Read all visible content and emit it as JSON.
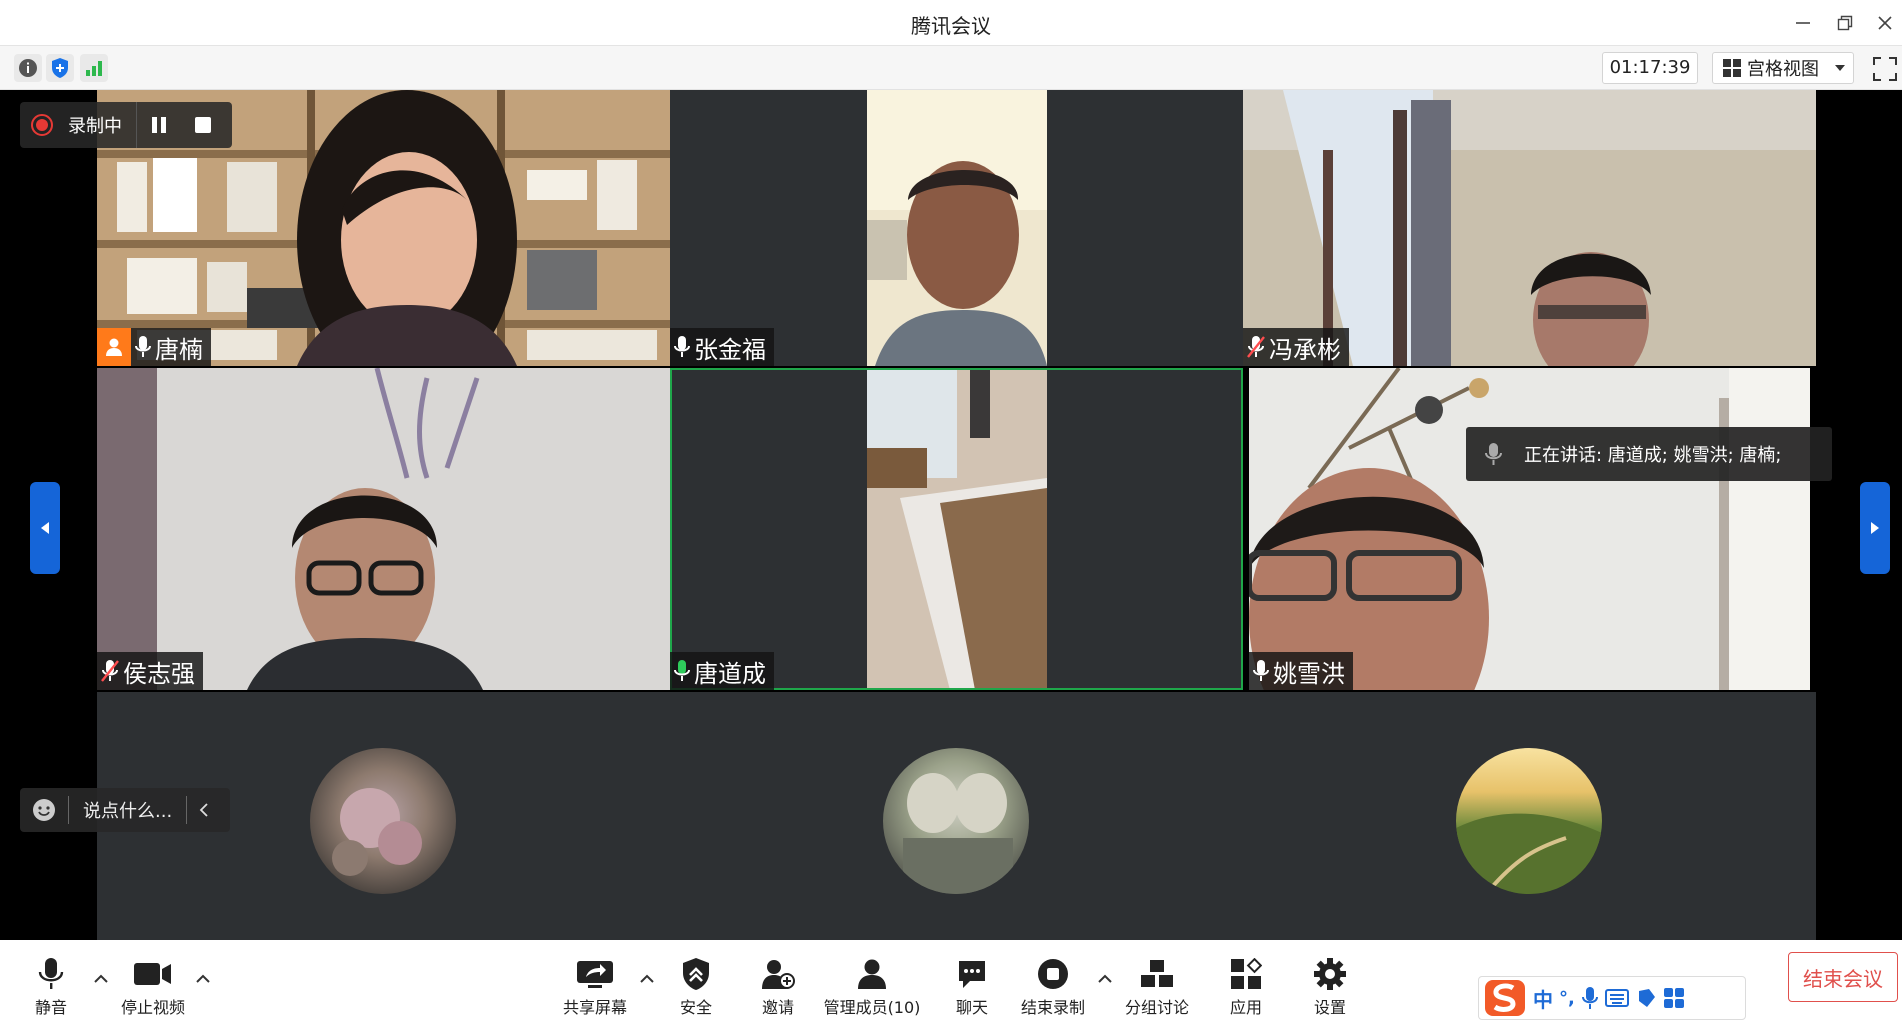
{
  "window": {
    "title": "腾讯会议"
  },
  "infobar": {
    "timer": "01:17:39",
    "view_mode": "宫格视图"
  },
  "recording": {
    "label": "录制中"
  },
  "speaking": {
    "text": "正在讲话: 唐道成; 姚雪洪; 唐楠;"
  },
  "chat": {
    "placeholder": "说点什么..."
  },
  "participants": [
    {
      "name": "唐楠",
      "host": true,
      "muted": false
    },
    {
      "name": "张金福",
      "host": false,
      "muted": false
    },
    {
      "name": "冯承彬",
      "host": false,
      "muted": true
    },
    {
      "name": "侯志强",
      "host": false,
      "muted": true
    },
    {
      "name": "唐道成",
      "host": false,
      "muted": false,
      "active_speaker": true
    },
    {
      "name": "姚雪洪",
      "host": false,
      "muted": false
    }
  ],
  "toolbar": {
    "mute": "静音",
    "stop_video": "停止视频",
    "share_screen": "共享屏幕",
    "security": "安全",
    "invite": "邀请",
    "manage_members": "管理成员(10)",
    "chat": "聊天",
    "end_recording": "结束录制",
    "breakout": "分组讨论",
    "apps": "应用",
    "settings": "设置",
    "end_meeting": "结束会议"
  },
  "ime": {
    "mode": "中",
    "punct": "°,"
  },
  "colors": {
    "accent_blue": "#1565d8",
    "active_green": "#1fa64a",
    "end_red": "#e0504c",
    "host_orange": "#ff7a1a"
  }
}
